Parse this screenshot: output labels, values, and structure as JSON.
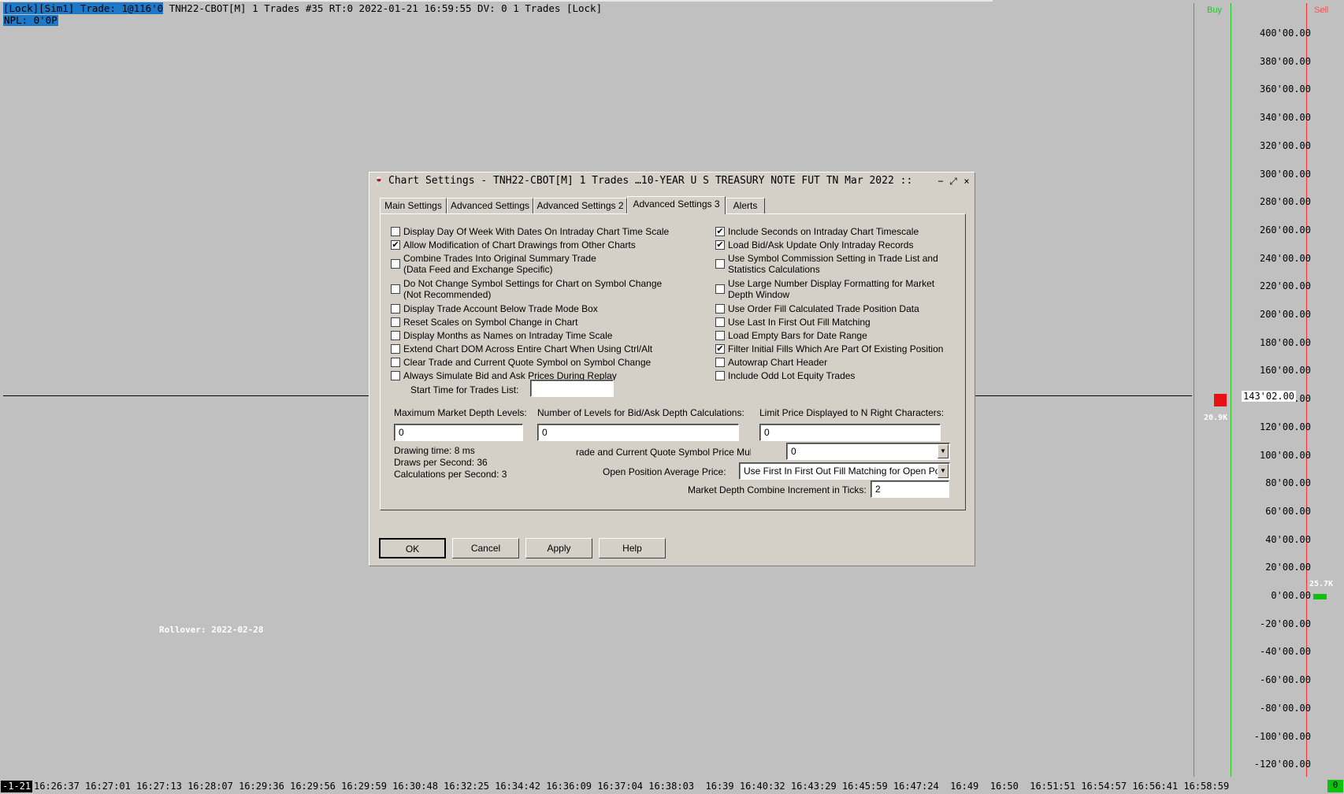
{
  "header": {
    "selected_text": "[Lock][Sim1]  Trade: 1@116'0",
    "rest_text": " TNH22-CBOT[M]  1 Trades  #35 RT:0 2022-01-21 16:59:55 DV: 0 1 Trades [Lock]",
    "npl_text": "NPL: 0'0P"
  },
  "chart": {
    "buy_label": "Buy",
    "sell_label": "Sell",
    "current_price": "143'02.00",
    "buy_volume": "20.9K",
    "sell_volume": "25.7K",
    "rollover": "Rollover: 2022-02-28",
    "price_labels": [
      "400'00.00",
      "380'00.00",
      "360'00.00",
      "340'00.00",
      "320'00.00",
      "300'00.00",
      "280'00.00",
      "260'00.00",
      "240'00.00",
      "220'00.00",
      "200'00.00",
      "180'00.00",
      "160'00.00",
      "140'00.00",
      "120'00.00",
      "100'00.00",
      "80'00.00",
      "60'00.00",
      "40'00.00",
      "20'00.00",
      "0'00.00",
      "-20'00.00",
      "-40'00.00",
      "-60'00.00",
      "-80'00.00",
      "-100'00.00",
      "-120'00.00"
    ],
    "time_left": "-1-21",
    "time_labels": "16:26:37 16:27:01 16:27:13 16:28:07 16:29:36 16:29:56 16:29:59 16:30:48 16:32:25 16:34:42 16:36:09 16:37:04 16:38:03  16:39 16:40:32 16:43:29 16:45:59 16:47:24  16:49  16:50  16:51:51 16:54:57 16:56:41 16:58:59",
    "corner_value": "0",
    "colors": {
      "background": "#c0c0c0",
      "buy_line": "#1fc81f",
      "sell_line": "#ff5050",
      "header_highlight": "#1e78c8"
    }
  },
  "dialog": {
    "title": "Chart Settings - TNH22-CBOT[M]  1 Trades …10-YEAR U S TREASURY NOTE FUT TN Mar 2022 ::",
    "minimize_icon": "−",
    "restore_icon": "⤢",
    "close_icon": "×",
    "tabs": [
      {
        "label": "Main Settings"
      },
      {
        "label": "Advanced Settings"
      },
      {
        "label": "Advanced Settings 2"
      },
      {
        "label": "Advanced Settings 3"
      },
      {
        "label": "Alerts"
      }
    ],
    "active_tab": "Advanced Settings 3",
    "left_checks": [
      {
        "label": "Display Day Of Week With Dates On Intraday Chart Time Scale",
        "checked": false
      },
      {
        "label": "Allow Modification of Chart Drawings from Other Charts",
        "checked": true
      },
      {
        "label": "Combine Trades Into Original Summary Trade",
        "label2": "(Data Feed and Exchange Specific)",
        "checked": false
      },
      {
        "label": "Do Not Change Symbol Settings for Chart on Symbol Change",
        "label2": "(Not Recommended)",
        "checked": false
      },
      {
        "label": "Display Trade Account Below Trade Mode Box",
        "checked": false
      },
      {
        "label": "Reset Scales on Symbol Change in Chart",
        "checked": false
      },
      {
        "label": "Display Months as Names on Intraday Time Scale",
        "checked": false
      },
      {
        "label": "Extend Chart DOM Across Entire Chart When Using Ctrl/Alt",
        "checked": false
      },
      {
        "label": "Clear Trade and Current Quote Symbol on Symbol Change",
        "checked": false
      },
      {
        "label": "Always Simulate Bid and Ask Prices During Replay",
        "checked": false
      }
    ],
    "right_checks": [
      {
        "label": "Include Seconds on Intraday Chart Timescale",
        "checked": true
      },
      {
        "label": "Load Bid/Ask Update Only Intraday Records",
        "checked": true
      },
      {
        "label": "Use Symbol Commission Setting in Trade List and",
        "label2": "Statistics Calculations",
        "checked": false
      },
      {
        "label": "Use Large Number Display Formatting for Market",
        "label2": "Depth Window",
        "checked": false
      },
      {
        "label": "Use Order Fill Calculated Trade Position Data",
        "checked": false
      },
      {
        "label": "Use Last In First Out Fill Matching",
        "checked": false
      },
      {
        "label": "Load Empty Bars for Date Range",
        "checked": false
      },
      {
        "label": "Filter Initial Fills Which Are Part Of Existing Position",
        "checked": true
      },
      {
        "label": "Autowrap Chart Header",
        "checked": false
      },
      {
        "label": "Include Odd Lot Equity Trades",
        "checked": false
      }
    ],
    "start_time_label": "Start Time for Trades List:",
    "start_time_value": "",
    "max_depth_label": "Maximum Market Depth Levels:",
    "max_depth_value": "0",
    "num_levels_label": "Number of Levels for Bid/Ask Depth Calculations:",
    "num_levels_value": "0",
    "limit_price_label": "Limit Price Displayed to N Right Characters:",
    "limit_price_value": "0",
    "drawing_time": "Drawing time: 8 ms",
    "draws_per_second": "Draws per Second: 36",
    "calcs_per_second": "Calculations per Second: 3",
    "multiplier_label": "rade and Current Quote Symbol Price Multiplier:",
    "multiplier_value": "0",
    "avg_price_label": "Open Position Average Price:",
    "avg_price_value": "Use First In First Out Fill Matching for Open Po",
    "combine_label": "Market Depth Combine Increment in Ticks:",
    "combine_value": "2",
    "ok_label": "OK",
    "cancel_label": "Cancel",
    "apply_label": "Apply",
    "help_label": "Help"
  }
}
